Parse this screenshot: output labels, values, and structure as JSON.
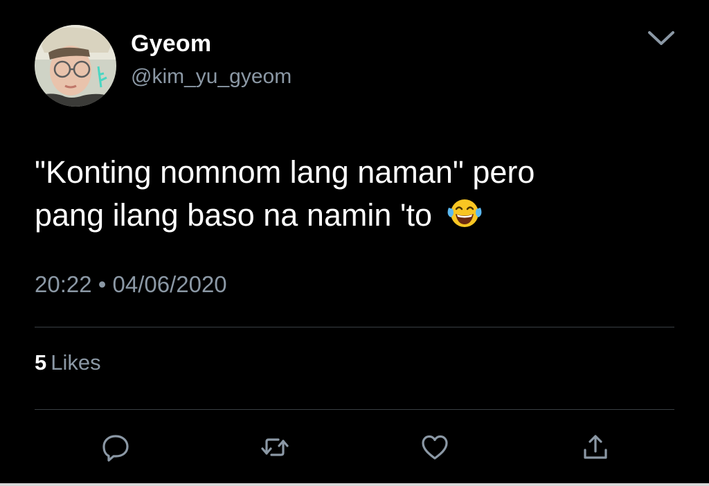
{
  "user": {
    "display_name": "Gyeom",
    "handle": "@kim_yu_gyeom"
  },
  "tweet": {
    "text_line1": "\"Konting nomnom lang naman\" pero",
    "text_line2": "pang ilang baso na namin 'to",
    "emoji": "face-with-tears-of-joy-icon",
    "time": "20:22",
    "separator": "•",
    "date": "04/06/2020"
  },
  "stats": {
    "likes_count": "5",
    "likes_label": "Likes"
  },
  "actions": {
    "reply": "reply-icon",
    "retweet": "retweet-icon",
    "like": "heart-icon",
    "share": "share-icon"
  },
  "colors": {
    "background": "#000000",
    "primary_text": "#ffffff",
    "secondary_text": "#8b98a5",
    "divider": "#3a3f44"
  }
}
